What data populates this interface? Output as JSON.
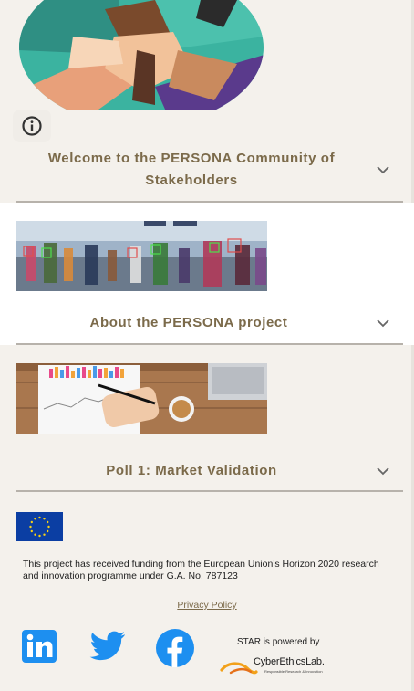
{
  "sections": [
    {
      "title": "Welcome to the PERSONA Community of Stakeholders"
    },
    {
      "title": "About the PERSONA project"
    },
    {
      "title": "Poll 1: Market Validation"
    }
  ],
  "footer": {
    "funding_text": "This project has received funding from the European Union's Horizon 2020 research and innovation programme under G.A. No. 787123",
    "privacy_label": "Privacy Policy",
    "powered_by": "STAR is powered by",
    "cel_name": "CyberEthicsLab.",
    "cel_tagline": "Responsible Research & Innovation"
  },
  "colors": {
    "background": "#f4f1ec",
    "title": "#7b6a4a",
    "divider": "#b7b2ab",
    "social": "#1d8ff0",
    "eu_blue": "#0b3ea3",
    "eu_star": "#f7d117"
  },
  "icons": [
    "info-icon",
    "chevron-down-icon",
    "linkedin-icon",
    "twitter-icon",
    "facebook-icon"
  ]
}
